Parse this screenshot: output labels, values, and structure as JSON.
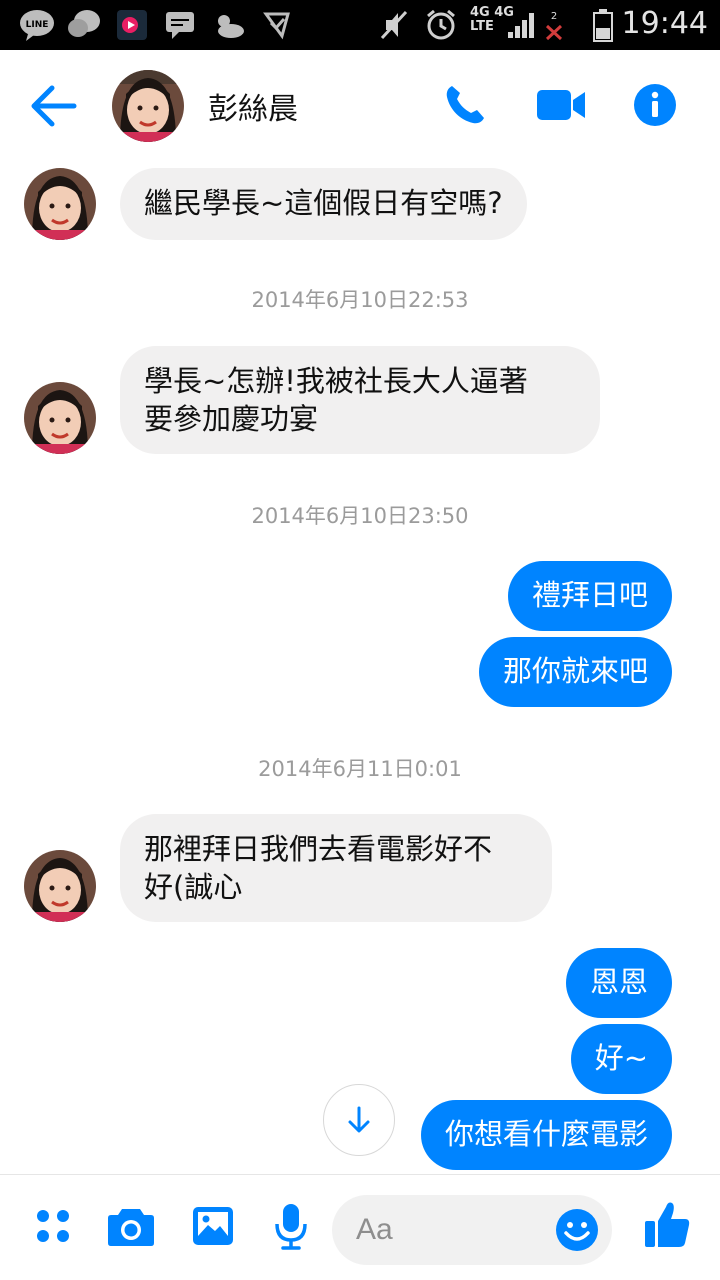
{
  "status_bar": {
    "time": "19:44",
    "network_label_top": "4G 4G",
    "network_label_bottom": "LTE",
    "sim2_label": "2"
  },
  "header": {
    "contact_name": "彭絲晨",
    "icons": [
      "back-arrow-icon",
      "phone-icon",
      "video-icon",
      "info-icon"
    ]
  },
  "messages": [
    {
      "direction": "in",
      "text": "繼民學長~這個假日有空嗎?"
    },
    {
      "type": "timestamp",
      "text": "2014年6月10日22:53"
    },
    {
      "direction": "in",
      "lines": [
        "學長~怎辦!我被社長大人逼著",
        "要參加慶功宴"
      ]
    },
    {
      "type": "timestamp",
      "text": "2014年6月10日23:50"
    },
    {
      "direction": "out",
      "text": "禮拜日吧"
    },
    {
      "direction": "out",
      "text": "那你就來吧"
    },
    {
      "type": "timestamp",
      "text": "2014年6月11日0:01"
    },
    {
      "direction": "in",
      "lines": [
        "那裡拜日我們去看電影好不",
        "好(誠心"
      ]
    },
    {
      "direction": "out",
      "text": "恩恩"
    },
    {
      "direction": "out",
      "text": "好~"
    },
    {
      "direction": "out",
      "text": "你想看什麼電影"
    }
  ],
  "composer": {
    "placeholder": "Aa",
    "icons": [
      "apps-icon",
      "camera-icon",
      "gallery-icon",
      "microphone-icon",
      "emoji-icon",
      "thumbs-up-icon"
    ]
  },
  "colors": {
    "accent": "#0084ff",
    "incoming_bubble": "#f1f0f0",
    "timestamp_text": "#9b9b9b"
  }
}
